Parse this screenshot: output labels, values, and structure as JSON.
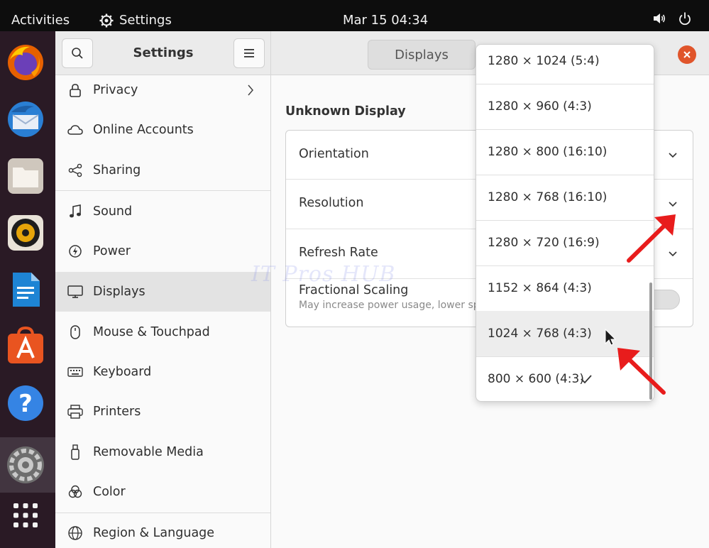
{
  "topbar": {
    "activities": "Activities",
    "app_menu": "Settings",
    "clock": "Mar 15  04:34"
  },
  "dock": {
    "apps": [
      "firefox-icon",
      "thunderbird-icon",
      "files-icon",
      "rhythmbox-icon",
      "libreoffice-writer-icon",
      "ubuntu-software-icon",
      "help-icon",
      "settings-icon",
      "app-grid-icon"
    ]
  },
  "window": {
    "title": "Settings",
    "tab": "Displays"
  },
  "sidebar": {
    "items": [
      {
        "label": "Privacy",
        "icon": "lock-icon"
      },
      {
        "label": "Online Accounts",
        "icon": "cloud-icon"
      },
      {
        "label": "Sharing",
        "icon": "share-icon"
      },
      {
        "label": "Sound",
        "icon": "music-note-icon"
      },
      {
        "label": "Power",
        "icon": "power-icon"
      },
      {
        "label": "Displays",
        "icon": "display-icon"
      },
      {
        "label": "Mouse & Touchpad",
        "icon": "mouse-icon"
      },
      {
        "label": "Keyboard",
        "icon": "keyboard-icon"
      },
      {
        "label": "Printers",
        "icon": "printer-icon"
      },
      {
        "label": "Removable Media",
        "icon": "usb-drive-icon"
      },
      {
        "label": "Color",
        "icon": "color-icon"
      },
      {
        "label": "Region & Language",
        "icon": "globe-icon"
      }
    ],
    "selected": "Displays"
  },
  "main": {
    "section_title": "Unknown Display",
    "rows": {
      "orientation": "Orientation",
      "resolution": "Resolution",
      "refresh_rate": "Refresh Rate",
      "fractional_scaling": "Fractional Scaling",
      "fractional_scaling_sub": "May increase power usage, lower sp"
    }
  },
  "resolution_popover": {
    "options": [
      "1280 × 1024 (5:4)",
      "1280 × 960 (4:3)",
      "1280 × 800 (16:10)",
      "1280 × 768 (16:10)",
      "1280 × 720 (16:9)",
      "1152 × 864 (4:3)",
      "1024 × 768 (4:3)",
      "800 × 600 (4:3)"
    ],
    "selected": "800 × 600 (4:3)",
    "hovered": "1024 × 768 (4:3)"
  },
  "watermark": "IT Pros HUB",
  "colors": {
    "close_button": "#e0552b",
    "annotation_arrow": "#e81c1c",
    "dock": "#2a1a25"
  }
}
